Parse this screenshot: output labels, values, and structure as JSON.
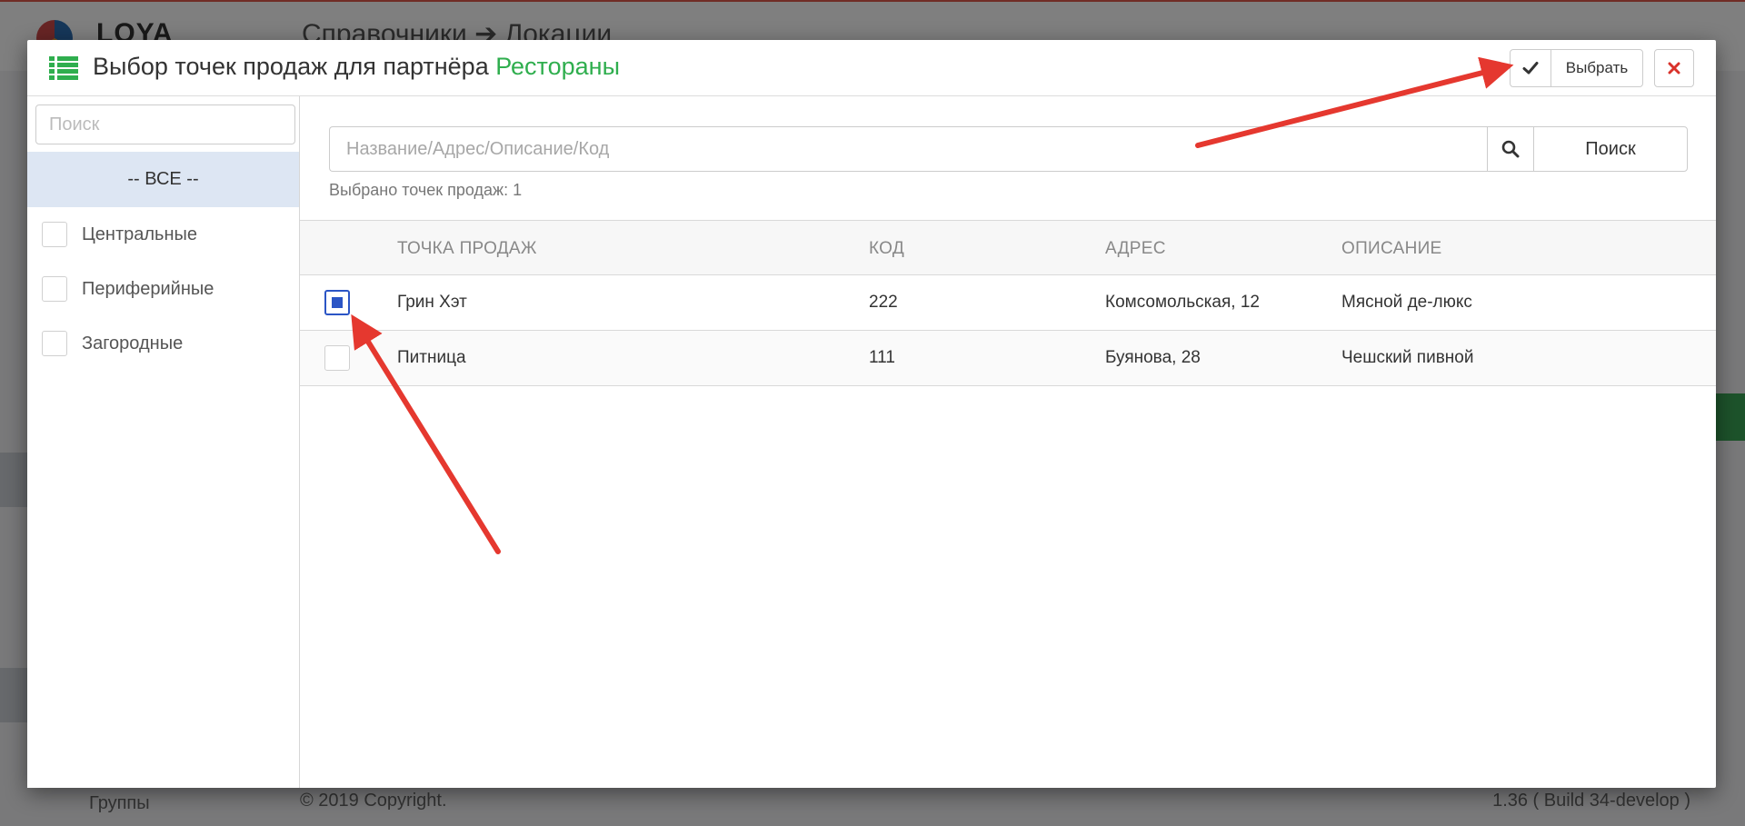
{
  "background": {
    "logo": "LOYA",
    "breadcrumb": "Справочники ➔ Локации",
    "footer_left": "Группы",
    "footer_copyright": "© 2019 Copyright.",
    "footer_build": "1.36 ( Build 34-develop )"
  },
  "modal": {
    "title_prefix": "Выбор точек продаж для партнёра ",
    "partner": "Рестораны",
    "select_label": "Выбрать",
    "check_icon": "check-icon",
    "close_icon": "close-icon",
    "list_icon": "list-icon"
  },
  "groups": {
    "search_placeholder": "Поиск",
    "all_label": "-- ВСЕ --",
    "items": [
      {
        "label": "Центральные",
        "checked": false
      },
      {
        "label": "Периферийные",
        "checked": false
      },
      {
        "label": "Загородные",
        "checked": false
      }
    ]
  },
  "search": {
    "placeholder": "Название/Адрес/Описание/Код",
    "value": "",
    "button_label": "Поиск",
    "icon": "search-icon"
  },
  "selected_text": "Выбрано точек продаж: 1",
  "table": {
    "columns": [
      "ТОЧКА ПРОДАЖ",
      "КОД",
      "АДРЕС",
      "ОПИСАНИЕ"
    ],
    "rows": [
      {
        "name": "Грин Хэт",
        "code": "222",
        "address": "Комсомольская, 12",
        "description": "Мясной де-люкс",
        "checked": true
      },
      {
        "name": "Питница",
        "code": "111",
        "address": "Буянова, 28",
        "description": "Чешский пивной",
        "checked": false
      }
    ]
  },
  "colors": {
    "accent_green": "#2fae4e",
    "checkbox_blue": "#2b55c5",
    "close_red": "#d9322b",
    "annotation_red": "#e5382f"
  }
}
